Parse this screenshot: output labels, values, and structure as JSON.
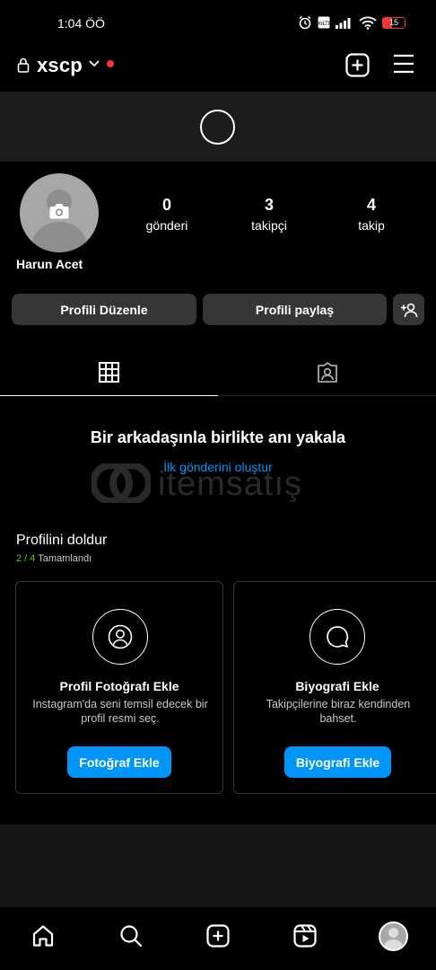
{
  "status_bar": {
    "time": "1:04 ÖÖ",
    "battery_level": "15",
    "icons": [
      "alarm-icon",
      "volte-icon",
      "signal-icon",
      "wifi-icon",
      "battery-icon"
    ]
  },
  "header": {
    "username": "xscp",
    "icons": [
      "lock-icon",
      "chevron-down-icon",
      "notification-dot",
      "new-post-icon",
      "menu-icon"
    ]
  },
  "profile": {
    "display_name": "Harun Acet",
    "stats": [
      {
        "value": "0",
        "label": "gönderi"
      },
      {
        "value": "3",
        "label": "takipçi"
      },
      {
        "value": "4",
        "label": "takip"
      }
    ]
  },
  "actions": {
    "edit_profile": "Profili Düzenle",
    "share_profile": "Profili paylaş"
  },
  "tabs": [
    {
      "name": "grid",
      "icon": "grid-icon",
      "active": true
    },
    {
      "name": "tagged",
      "icon": "tagged-icon",
      "active": false
    }
  ],
  "empty_state": {
    "title": "Bir arkadaşınla birlikte anı yakala",
    "link": "İlk gönderini oluştur"
  },
  "watermark": {
    "text": "itemsatış"
  },
  "complete_profile": {
    "title": "Profilini doldur",
    "progress_done": "2 / 4",
    "progress_label": "Tamamlandı",
    "cards": [
      {
        "title": "Profil Fotoğrafı Ekle",
        "description": "Instagram'da seni temsil edecek bir profil resmi seç.",
        "button": "Fotoğraf Ekle",
        "icon": "profile-photo-icon"
      },
      {
        "title": "Biyografi Ekle",
        "description": "Takipçilerine biraz kendinden bahset.",
        "button": "Biyografi Ekle",
        "icon": "speech-bubble-icon"
      }
    ]
  },
  "bottom_nav": [
    "home-icon",
    "search-icon",
    "create-icon",
    "reels-icon",
    "profile-avatar"
  ],
  "colors": {
    "accent_blue": "#0095f6",
    "progress_green": "#58c322",
    "notification_red": "#ff3040",
    "button_gray": "#363636"
  }
}
